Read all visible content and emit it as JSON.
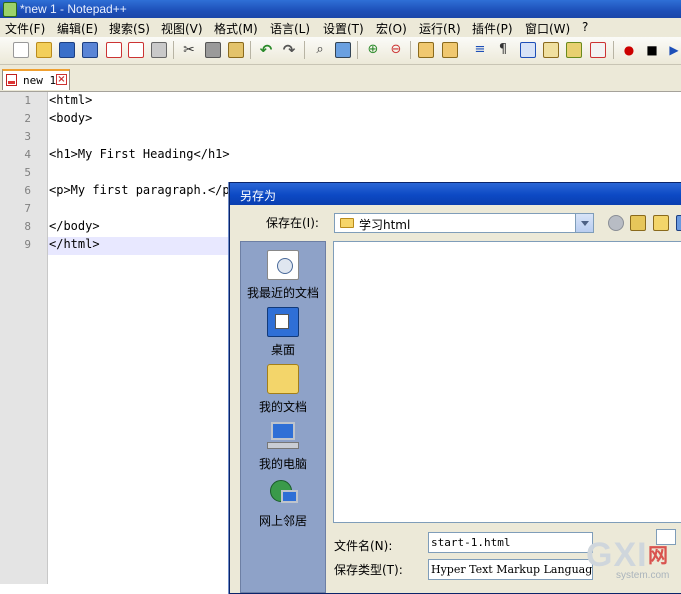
{
  "window": {
    "title": "*new 1 - Notepad++"
  },
  "menu": [
    "文件(F)",
    "编辑(E)",
    "搜索(S)",
    "视图(V)",
    "格式(M)",
    "语言(L)",
    "设置(T)",
    "宏(O)",
    "运行(R)",
    "插件(P)",
    "窗口(W)",
    "?"
  ],
  "tabs": [
    {
      "label": "new 1"
    }
  ],
  "editor": {
    "line_numbers": [
      "1",
      "2",
      "3",
      "4",
      "5",
      "6",
      "7",
      "8",
      "9"
    ],
    "lines": [
      "<html>",
      "<body>",
      "",
      "<h1>My First Heading</h1>",
      "",
      "<p>My first paragraph.</p>",
      "",
      "</body>",
      "</html>"
    ]
  },
  "dialog": {
    "title": "另存为",
    "save_in_label": "保存在(I):",
    "current_folder": "学习html",
    "places": [
      "我最近的文档",
      "桌面",
      "我的文档",
      "我的电脑",
      "网上邻居"
    ],
    "filename_label": "文件名(N):",
    "filename_value": "start-1.html",
    "filetype_label": "保存类型(T):",
    "filetype_value": "Hyper Text Markup Language"
  },
  "watermark": {
    "text": "GXI",
    "cn": "网",
    "sub": "system.com"
  },
  "colors": {
    "titlebar": "#1d4fb8",
    "chrome": "#ece9d8",
    "current_line": "#e8e8ff",
    "places_bar": "#8ea2c8"
  }
}
